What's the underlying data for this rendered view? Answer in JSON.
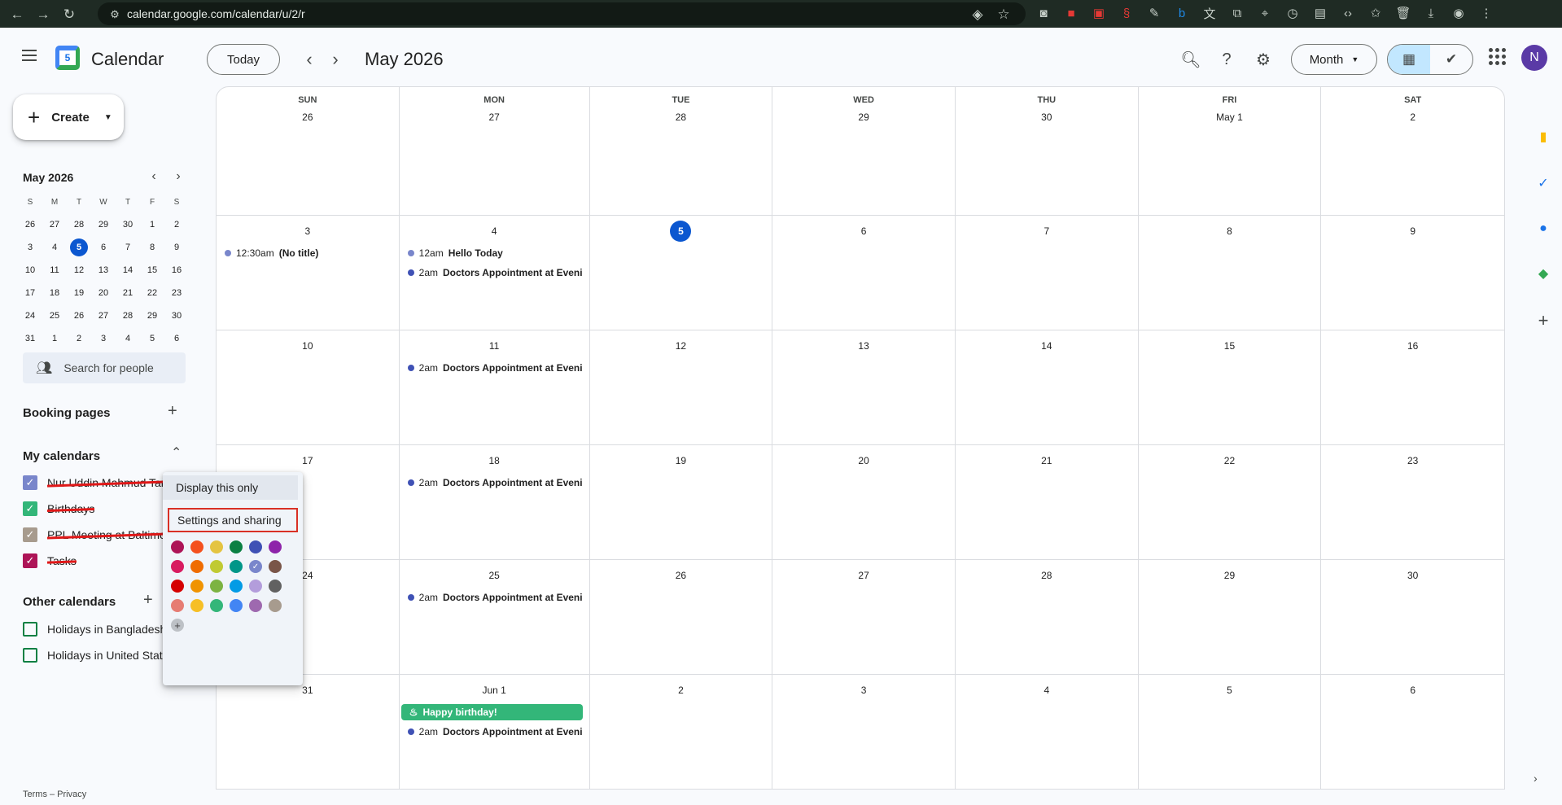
{
  "browser": {
    "url": "calendar.google.com/calendar/u/2/r"
  },
  "header": {
    "app_name": "Calendar",
    "logo_day": "5",
    "today_label": "Today",
    "period": "May 2026",
    "view": "Month",
    "avatar": "N"
  },
  "sidebar": {
    "create_label": "Create",
    "mini_title": "May 2026",
    "mini_days": [
      "S",
      "M",
      "T",
      "W",
      "T",
      "F",
      "S"
    ],
    "mini_weeks": [
      [
        "26",
        "27",
        "28",
        "29",
        "30",
        "1",
        "2"
      ],
      [
        "3",
        "4",
        "5",
        "6",
        "7",
        "8",
        "9"
      ],
      [
        "10",
        "11",
        "12",
        "13",
        "14",
        "15",
        "16"
      ],
      [
        "17",
        "18",
        "19",
        "20",
        "21",
        "22",
        "23"
      ],
      [
        "24",
        "25",
        "26",
        "27",
        "28",
        "29",
        "30"
      ],
      [
        "31",
        "1",
        "2",
        "3",
        "4",
        "5",
        "6"
      ]
    ],
    "mini_selected": "5",
    "search_people": "Search for people",
    "booking_pages": "Booking pages",
    "my_calendars_title": "My calendars",
    "my_calendars": [
      {
        "label": "Nur Uddin Mahmud Tan",
        "color": "#7986cb"
      },
      {
        "label": "Birthdays",
        "color": "#33b679"
      },
      {
        "label": "PPL Meeting at Baltimo",
        "color": "#a79b8e"
      },
      {
        "label": "Tasks",
        "color": "#ad1457"
      }
    ],
    "other_calendars_title": "Other calendars",
    "other_calendars": [
      {
        "label": "Holidays in Bangladesh",
        "color": "#0b8043"
      },
      {
        "label": "Holidays in United States",
        "color": "#0b8043"
      }
    ],
    "footer": "Terms – Privacy"
  },
  "calendar": {
    "dows": [
      "SUN",
      "MON",
      "TUE",
      "WED",
      "THU",
      "FRI",
      "SAT"
    ],
    "weeks": [
      [
        "26",
        "27",
        "28",
        "29",
        "30",
        "May 1",
        "2"
      ],
      [
        "3",
        "4",
        "5",
        "6",
        "7",
        "8",
        "9"
      ],
      [
        "10",
        "11",
        "12",
        "13",
        "14",
        "15",
        "16"
      ],
      [
        "17",
        "18",
        "19",
        "20",
        "21",
        "22",
        "23"
      ],
      [
        "24",
        "25",
        "26",
        "27",
        "28",
        "29",
        "30"
      ],
      [
        "31",
        "Jun 1",
        "2",
        "3",
        "4",
        "5",
        "6"
      ]
    ],
    "today_cell": "1-2",
    "events": {
      "1-0": [
        {
          "time": "12:30am",
          "title": "(No title)",
          "color": "#7986cb"
        }
      ],
      "1-1": [
        {
          "time": "12am",
          "title": "Hello Today",
          "color": "#7986cb"
        },
        {
          "time": "2am",
          "title": "Doctors Appointment at Eveni",
          "color": "#3f51b5"
        }
      ],
      "2-1": [
        {
          "time": "2am",
          "title": "Doctors Appointment at Eveni",
          "color": "#3f51b5"
        }
      ],
      "3-1": [
        {
          "time": "2am",
          "title": "Doctors Appointment at Eveni",
          "color": "#3f51b5"
        }
      ],
      "4-1": [
        {
          "time": "2am",
          "title": "Doctors Appointment at Eveni",
          "color": "#3f51b5"
        }
      ],
      "5-1": [
        {
          "birthday": "Happy birthday!"
        },
        {
          "time": "2am",
          "title": "Doctors Appointment at Eveni",
          "color": "#3f51b5"
        }
      ]
    }
  },
  "popup": {
    "display_only": "Display this only",
    "settings_sharing": "Settings and sharing",
    "colors": [
      "#ad1457",
      "#f4511e",
      "#e4c441",
      "#0b8043",
      "#3f51b5",
      "#8e24aa",
      "#d81b60",
      "#ef6c00",
      "#c0ca33",
      "#009688",
      "#7986cb",
      "#795548",
      "#d50000",
      "#f09300",
      "#7cb342",
      "#039be5",
      "#b39ddb",
      "#616161",
      "#e67c73",
      "#f6bf26",
      "#33b679",
      "#4285f4",
      "#9e69af",
      "#a79b8e"
    ],
    "selected_color": "#7986cb"
  }
}
